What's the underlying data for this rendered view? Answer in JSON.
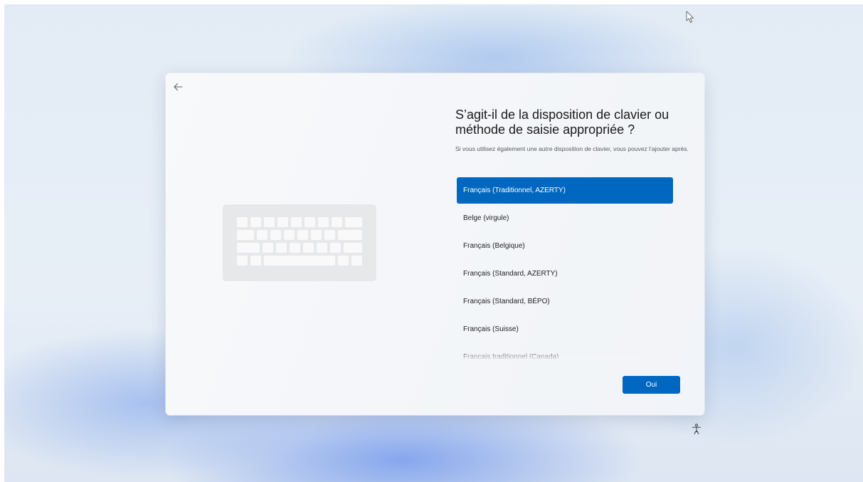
{
  "setup": {
    "back_icon": "arrow-left-icon",
    "illustration_icon": "keyboard-icon",
    "title": "S’agit-il de la disposition de clavier ou méthode de saisie appropriée ?",
    "subtitle": "Si vous utilisez également une autre disposition de clavier, vous pouvez l’ajouter après.",
    "layouts": [
      {
        "label": "Français (Traditionnel, AZERTY)",
        "selected": true
      },
      {
        "label": "Belge (virgule)",
        "selected": false
      },
      {
        "label": "Français (Belgique)",
        "selected": false
      },
      {
        "label": "Français (Standard, AZERTY)",
        "selected": false
      },
      {
        "label": "Français (Standard, BÉPO)",
        "selected": false
      },
      {
        "label": "Français (Suisse)",
        "selected": false
      },
      {
        "label": "Français traditionnel (Canada)",
        "selected": false
      }
    ],
    "confirm_label": "Oui"
  },
  "desktop": {
    "cursor_icon": "mouse-pointer-icon",
    "accessibility_icon": "accessibility-icon"
  },
  "colors": {
    "accent": "#0067c0",
    "dialog_background": "#f4f6f9",
    "text_primary": "#1b1b1b",
    "text_secondary": "#555a60"
  }
}
